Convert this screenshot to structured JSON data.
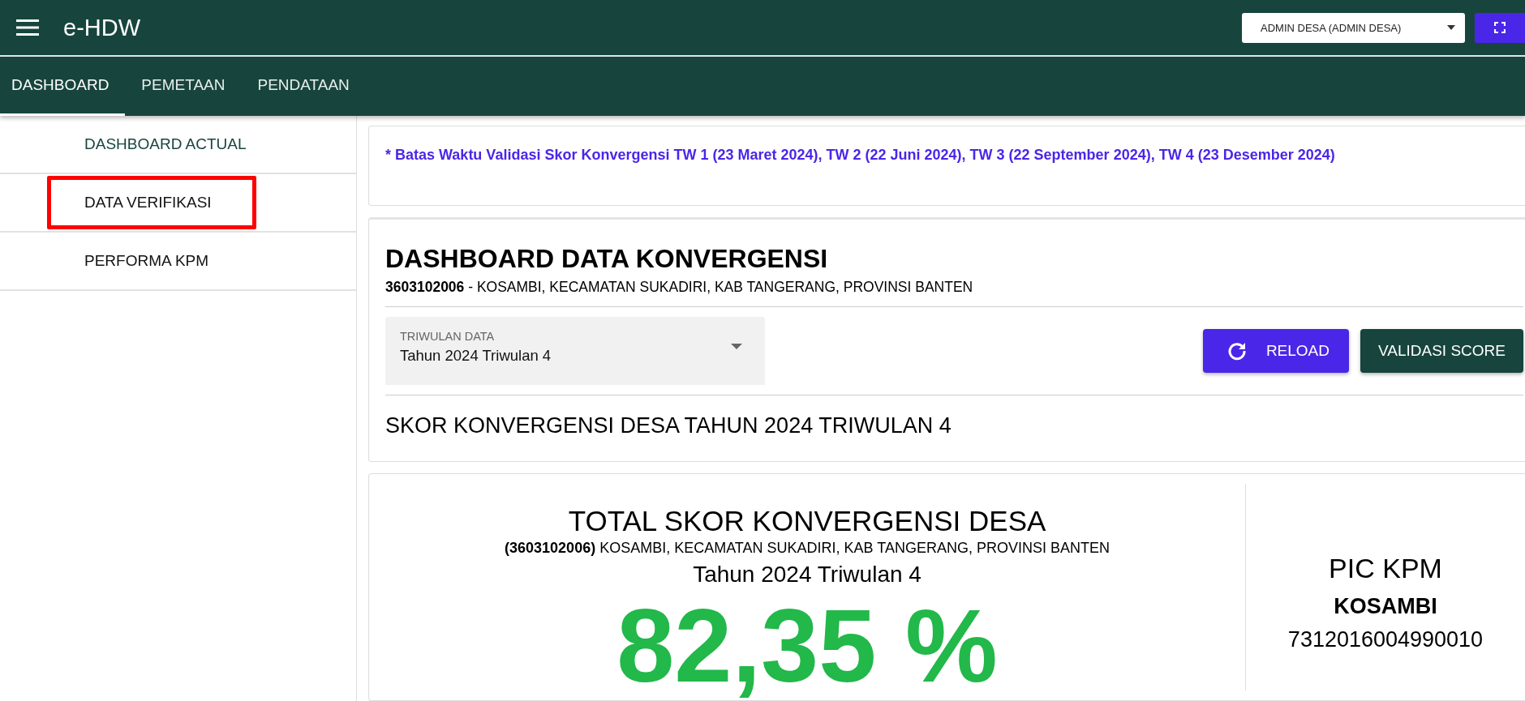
{
  "app": {
    "title": "e-HDW",
    "user_select": "ADMIN DESA (ADMIN DESA)"
  },
  "tabs": [
    {
      "label": "DASHBOARD",
      "selected": true
    },
    {
      "label": "PEMETAAN",
      "selected": false
    },
    {
      "label": "PENDATAAN",
      "selected": false
    }
  ],
  "sidebar": {
    "items": [
      {
        "label": "DASHBOARD ACTUAL",
        "selected": true,
        "highlighted": false
      },
      {
        "label": "DATA VERIFIKASI",
        "selected": false,
        "highlighted": true
      },
      {
        "label": "PERFORMA KPM",
        "selected": false,
        "highlighted": false
      }
    ]
  },
  "notice": "* Batas Waktu Validasi Skor Konvergensi TW 1 (23 Maret 2024), TW 2 (22 Juni 2024), TW 3 (22 September 2024), TW 4 (23 Desember 2024)",
  "dashboard": {
    "title": "DASHBOARD DATA KONVERGENSI",
    "location": "**3603102006** - KOSAMBI, KECAMATAN SUKADIRI, KAB TANGERANG, PROVINSI BANTEN",
    "select": {
      "label": "TRIWULAN DATA",
      "value": "Tahun 2024 Triwulan 4"
    },
    "buttons": [
      {
        "label": "RELOAD",
        "kind": "primary"
      },
      {
        "label": "VALIDASI SCORE",
        "kind": "secondary"
      }
    ],
    "score_heading": "SKOR KONVERGENSI DESA TAHUN 2024 TRIWULAN 4"
  },
  "total": {
    "title": "TOTAL SKOR KONVERGENSI DESA",
    "location": "**(3603102006)** KOSAMBI, KECAMATAN SUKADIRI, KAB TANGERANG, PROVINSI BANTEN",
    "period": "Tahun 2024 Triwulan 4",
    "score": "82,35 %"
  },
  "pic": {
    "title": "PIC KPM",
    "name": "KOSAMBI",
    "number": "7312016004990010"
  }
}
